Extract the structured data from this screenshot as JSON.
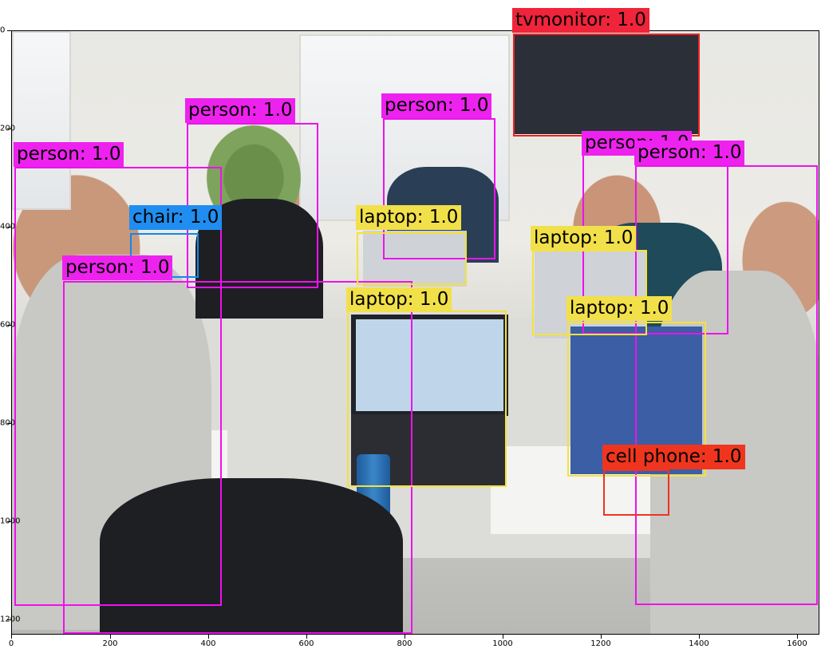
{
  "detections": [
    {
      "label": "tvmonitor: 1.0",
      "class": "tvmonitor",
      "score": "1.0"
    },
    {
      "label": "person: 1.0",
      "class": "person",
      "score": "1.0"
    },
    {
      "label": "person: 1.0",
      "class": "person",
      "score": "1.0"
    },
    {
      "label": "person: 1.0",
      "class": "person",
      "score": "1.0"
    },
    {
      "label": "person: 1.0",
      "class": "person",
      "score": "1.0"
    },
    {
      "label": "person: 1.0",
      "class": "person",
      "score": "1.0"
    },
    {
      "label": "person: 1.0",
      "class": "person",
      "score": "1.0"
    },
    {
      "label": "chair: 1.0",
      "class": "chair",
      "score": "1.0"
    },
    {
      "label": "laptop: 1.0",
      "class": "laptop",
      "score": "1.0"
    },
    {
      "label": "laptop: 1.0",
      "class": "laptop",
      "score": "1.0"
    },
    {
      "label": "laptop: 1.0",
      "class": "laptop",
      "score": "1.0"
    },
    {
      "label": "laptop: 1.0",
      "class": "laptop",
      "score": "1.0"
    },
    {
      "label": "cell phone: 1.0",
      "class": "cell phone",
      "score": "1.0"
    }
  ],
  "axes": {
    "x_ticks": [
      "0",
      "200",
      "400",
      "600",
      "800",
      "1000",
      "1200",
      "1400",
      "1600"
    ],
    "y_ticks": [
      "0",
      "200",
      "400",
      "600",
      "800",
      "1000",
      "1200"
    ]
  },
  "colors": {
    "person": "#ee11ee",
    "laptop": "#f4e23a",
    "chair": "#1188ee",
    "tvmonitor": "#ee2222",
    "cell phone": "#ee3322"
  }
}
